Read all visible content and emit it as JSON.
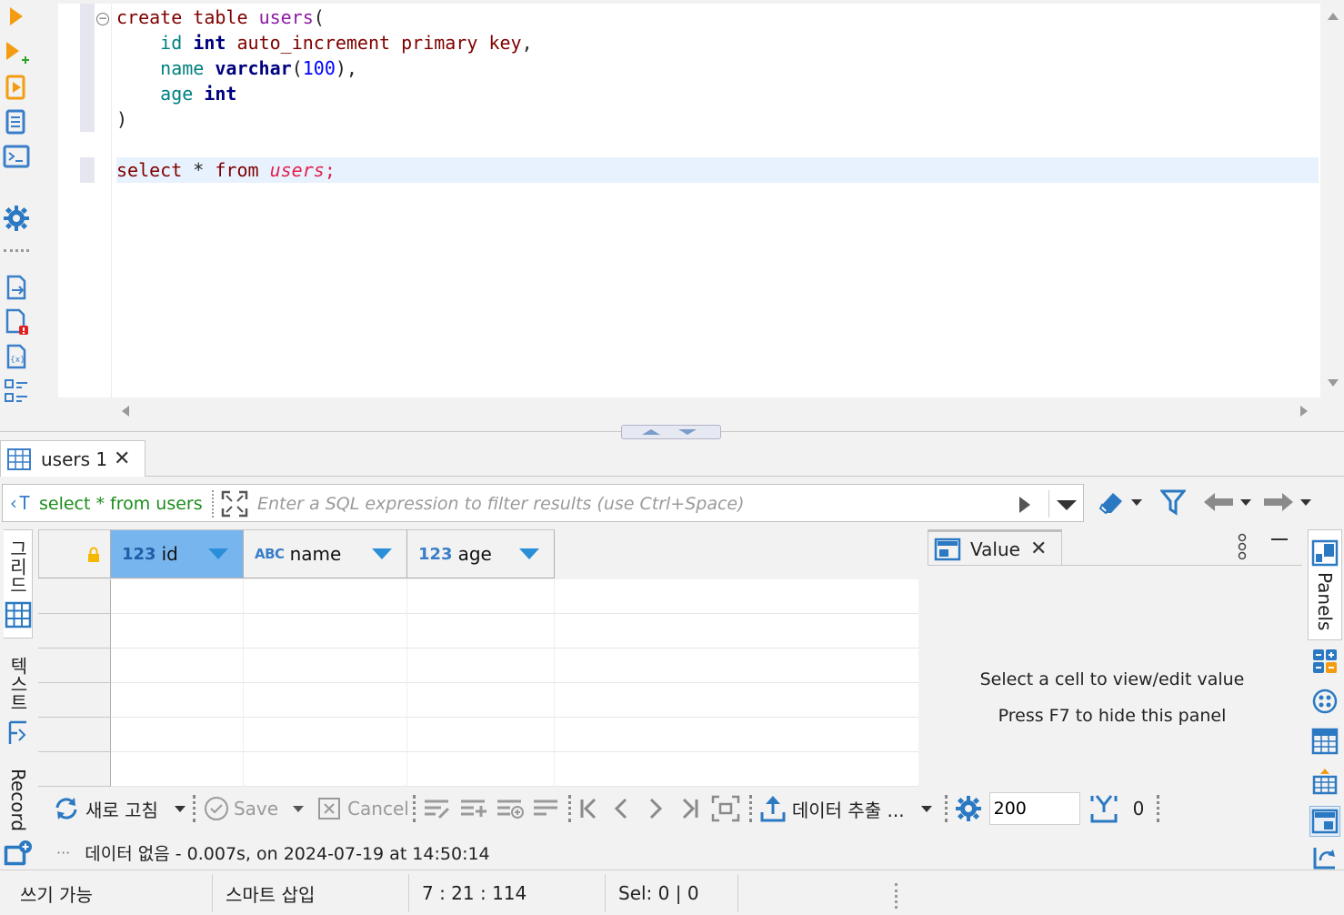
{
  "editor": {
    "lines": [
      {
        "parts": [
          [
            "kw",
            "create"
          ],
          [
            "pn",
            " "
          ],
          [
            "kw",
            "table"
          ],
          [
            "pn",
            " "
          ],
          [
            "tbl",
            "users"
          ],
          [
            "pn",
            "("
          ]
        ]
      },
      {
        "parts": [
          [
            "pn",
            "    "
          ],
          [
            "col",
            "id"
          ],
          [
            "pn",
            " "
          ],
          [
            "kw2",
            "int"
          ],
          [
            "pn",
            " "
          ],
          [
            "kw",
            "auto_increment"
          ],
          [
            "pn",
            " "
          ],
          [
            "kw",
            "primary"
          ],
          [
            "pn",
            " "
          ],
          [
            "kw",
            "key"
          ],
          [
            "pn",
            ","
          ]
        ]
      },
      {
        "parts": [
          [
            "pn",
            "    "
          ],
          [
            "col",
            "name"
          ],
          [
            "pn",
            " "
          ],
          [
            "kw2",
            "varchar"
          ],
          [
            "pn",
            "("
          ],
          [
            "num",
            "100"
          ],
          [
            "pn",
            "),"
          ]
        ]
      },
      {
        "parts": [
          [
            "pn",
            "    "
          ],
          [
            "col",
            "age"
          ],
          [
            "pn",
            " "
          ],
          [
            "kw2",
            "int"
          ]
        ]
      },
      {
        "parts": [
          [
            "pn",
            ")"
          ]
        ]
      },
      {
        "parts": []
      },
      {
        "parts": [
          [
            "kw",
            "select"
          ],
          [
            "pn",
            " * "
          ],
          [
            "kw",
            "from"
          ],
          [
            "pn",
            " "
          ],
          [
            "it",
            "users"
          ],
          [
            "red",
            ";"
          ]
        ]
      }
    ]
  },
  "results_tab": {
    "label": "users 1"
  },
  "filter": {
    "query": "select * from users",
    "placeholder": "Enter a SQL expression to filter results (use Ctrl+Space)"
  },
  "vertical_tabs": {
    "grid": "그리드",
    "text": "텍스트",
    "record": "Record"
  },
  "grid": {
    "columns": [
      {
        "type": "123",
        "name": "id",
        "selected": true
      },
      {
        "type": "ABC",
        "name": "name",
        "selected": false
      },
      {
        "type": "123",
        "name": "age",
        "selected": false
      }
    ],
    "rows": []
  },
  "value_panel": {
    "tab_label": "Value",
    "message1": "Select a cell to view/edit value",
    "message2": "Press F7 to hide this panel"
  },
  "right_strip": {
    "panels_label": "Panels"
  },
  "toolbar": {
    "refresh": "새로 고침",
    "save": "Save",
    "cancel": "Cancel",
    "export": "데이터 추출 ...",
    "limit": "200",
    "row_count": "0"
  },
  "status_line": {
    "text": "데이터 없음 - 0.007s, on 2024-07-19 at 14:50:14"
  },
  "statusbar": {
    "mode": "쓰기 가능",
    "insert": "스마트 삽입",
    "position": "7 : 21 : 114",
    "selection": "Sel: 0 | 0"
  },
  "colors": {
    "accent": "#3a7ec9",
    "selected_header": "#77b5ee",
    "run_orange": "#f39c12",
    "current_line": "#e8f2fe"
  }
}
